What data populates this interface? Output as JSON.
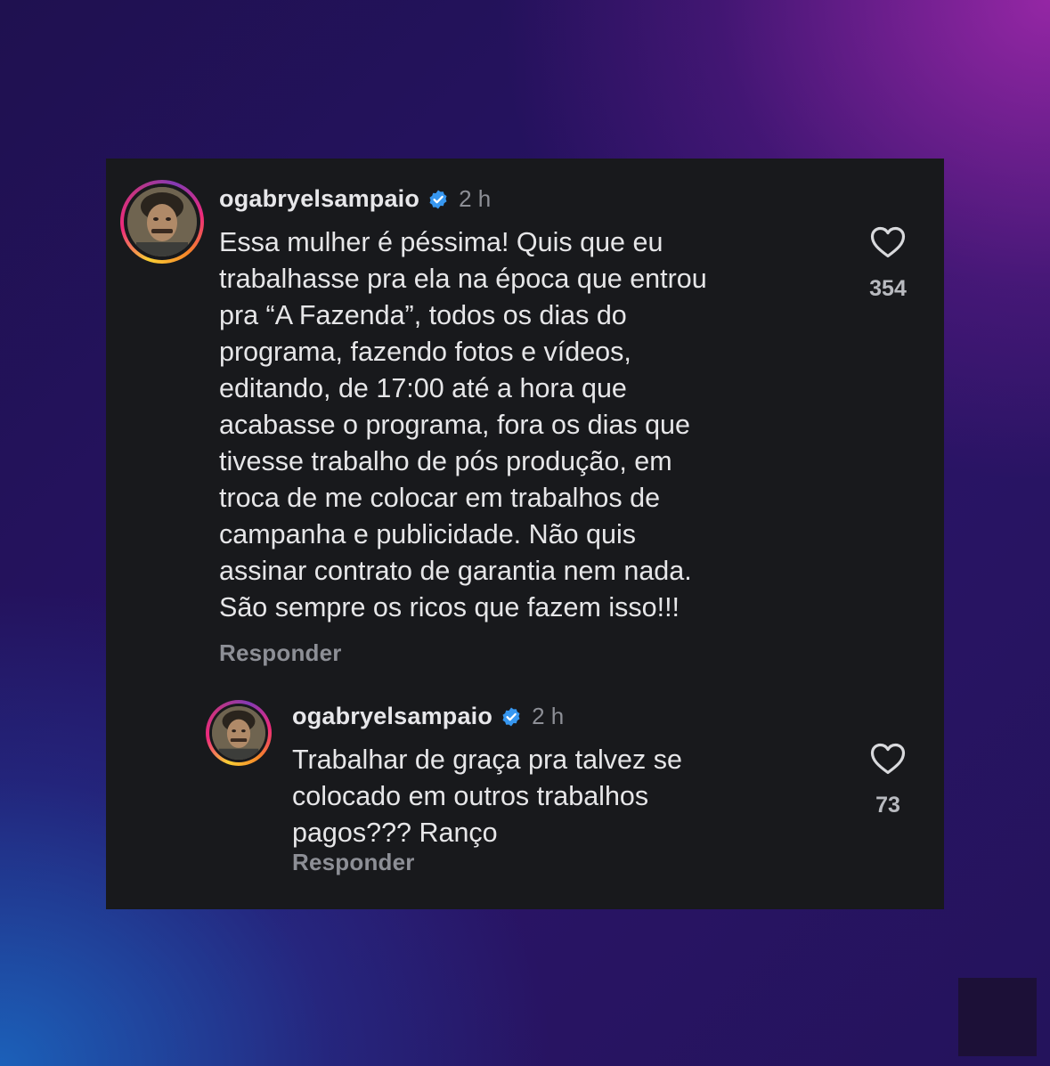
{
  "comments": [
    {
      "username": "ogabryelsampaio",
      "time": "2 h",
      "text": "Essa mulher é péssima! Quis que eu\ntrabalhasse pra ela na época que entrou\npra “A Fazenda”, todos os dias do\nprograma, fazendo fotos e vídeos,\neditando, de 17:00 até a hora que\nacabasse o programa, fora os dias que\ntivesse trabalho de pós produção, em\ntroca de me colocar em trabalhos de\ncampanha e publicidade. Não quis\nassinar contrato de garantia nem nada.\nSão sempre os ricos que fazem isso!!!",
      "reply_label": "Responder",
      "likes": "354"
    },
    {
      "username": "ogabryelsampaio",
      "time": "2 h",
      "text": "Trabalhar de graça pra talvez se\ncolocado em outros trabalhos\npagos??? Ranço",
      "reply_label": "Responder",
      "likes": "73"
    }
  ],
  "icons": {
    "verified": "verified-badge-icon",
    "like": "heart-icon"
  },
  "colors": {
    "card_background": "#18191c",
    "verified_blue": "#3797f0",
    "username": "#e7e7ea",
    "muted_text": "#8d8f96"
  }
}
